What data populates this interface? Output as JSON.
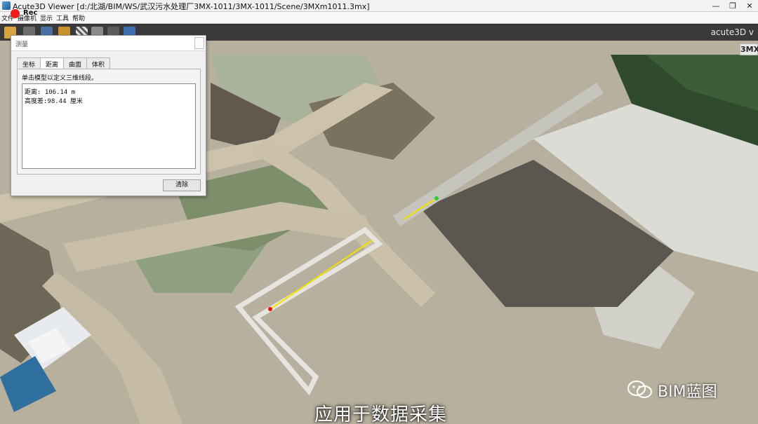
{
  "window": {
    "title": "Acute3D Viewer [d:/北湖/BIM/WS/武汉污水处理厂3MX-1011/3MX-1011/Scene/3MXm1011.3mx]",
    "minimize": "—",
    "maximize": "❐",
    "close": "✕"
  },
  "menu": [
    "文件",
    "摄像机",
    "显示",
    "工具",
    "帮助"
  ],
  "recording": {
    "label": "Rec"
  },
  "toolbar": {
    "brand": "acute3D v"
  },
  "view_tab": "3MX",
  "dialog": {
    "title": "测量",
    "tabs": [
      "坐标",
      "距离",
      "曲面",
      "体积"
    ],
    "active_tab": "距离",
    "instruction": "单击模型以定义三维线段。",
    "results": [
      "距离:  106.14 m",
      "高度差:98.44 厘米"
    ],
    "clear_button": "清除"
  },
  "caption": "应用于数据采集",
  "watermark": {
    "text": "BIM蓝图",
    "icon": "wechat-icon"
  }
}
